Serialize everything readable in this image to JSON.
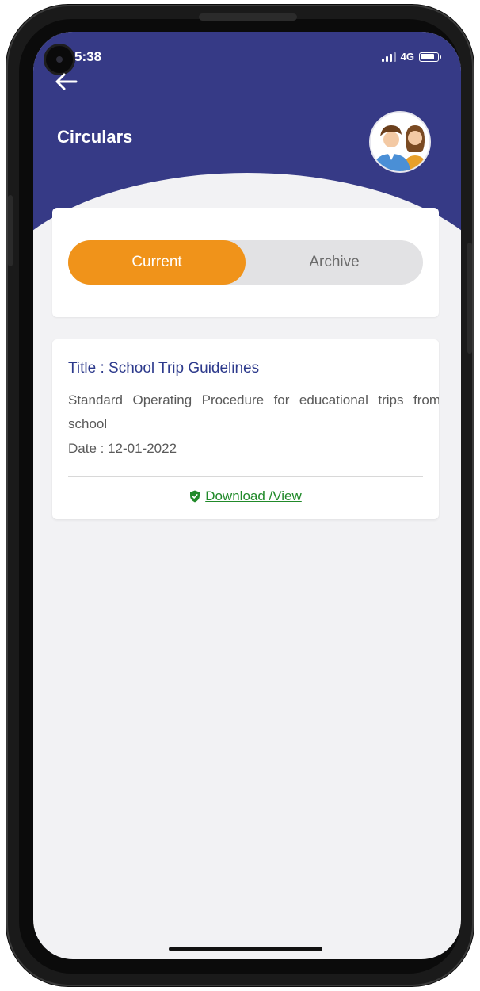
{
  "status_bar": {
    "time": "5:38",
    "network": "4G"
  },
  "header": {
    "title": "Circulars",
    "back_icon": "arrow-left-icon",
    "avatar_icon": "parents-avatar"
  },
  "tabs": [
    {
      "label": "Current",
      "selected": true
    },
    {
      "label": "Archive",
      "selected": false
    }
  ],
  "circulars": [
    {
      "title": "Title : School Trip Guidelines",
      "description": "Standard Operating Procedure for educational trips from school",
      "date": "Date : 12-01-2022",
      "action_label": "Download /View",
      "action_icon": "shield-check-icon"
    }
  ],
  "colors": {
    "header": "#363a86",
    "accent": "#f0931a",
    "title_text": "#2d3a8c",
    "link": "#218a2a",
    "background": "#f2f2f4"
  }
}
